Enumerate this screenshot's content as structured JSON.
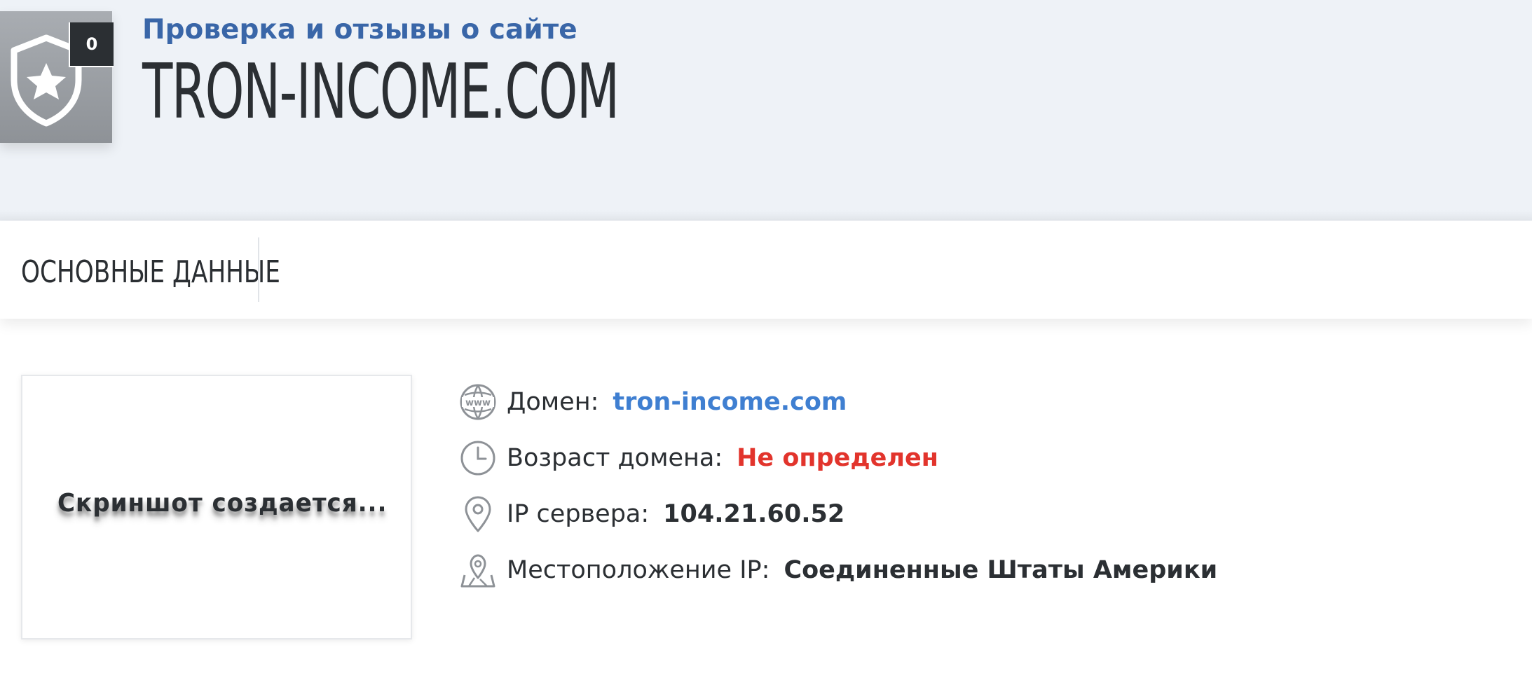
{
  "header": {
    "review_count": "0",
    "subtitle": "Проверка и отзывы о сайте",
    "title": "TRON-INCOME.COM"
  },
  "tabs": [
    {
      "label": "ОСНОВНЫЕ ДАННЫЕ"
    }
  ],
  "screenshot": {
    "status_text": "Скриншот создается..."
  },
  "info": {
    "domain": {
      "label": "Домен:",
      "value": "tron-income.com"
    },
    "domain_age": {
      "label": "Возраст домена:",
      "value": "Не определен"
    },
    "server_ip": {
      "label": "IP сервера:",
      "value": "104.21.60.52"
    },
    "ip_location": {
      "label": "Местоположение IP:",
      "value": "Соединенные Штаты Америки"
    },
    "icon_names": [
      "globe-www-icon",
      "clock-icon",
      "map-pin-icon",
      "map-location-icon"
    ]
  },
  "colors": {
    "header_bg": "#eef2f7",
    "subtitle": "#3966a8",
    "title": "#2b2f33",
    "link": "#3f7fd1",
    "warning": "#e2342c",
    "badge_bg": "#9a9ea3"
  }
}
